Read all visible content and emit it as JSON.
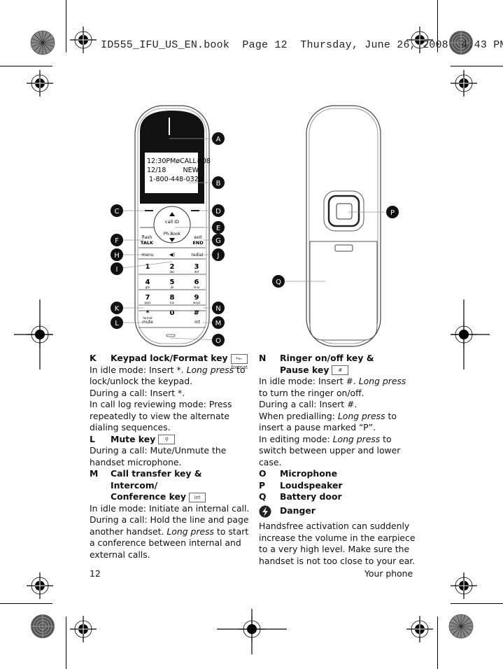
{
  "print_header": "ID555_IFU_US_EN.book  Page 12  Thursday, June 26, 2008  4:43 PM",
  "figure": {
    "lcd_lines": [
      "12:30PMøCALL#08",
      "12/18        NEW",
      " 1-800-448-0329"
    ],
    "callouts_front": [
      "A",
      "B",
      "C",
      "D",
      "E",
      "F",
      "G",
      "H",
      "I",
      "J",
      "K",
      "L",
      "M",
      "N",
      "O"
    ],
    "callouts_back": [
      "P",
      "Q"
    ],
    "keys": {
      "call_id": "call ID",
      "ph_book": "Ph.Book",
      "flash": "flash",
      "talk": "TALK",
      "exit": "exit",
      "end": "END",
      "menu": "menu",
      "redial": "redial",
      "mute": "mute",
      "int": "int",
      "format": "format",
      "digits": [
        {
          "d": "1",
          "s": ""
        },
        {
          "d": "2",
          "s": "abc"
        },
        {
          "d": "3",
          "s": "def"
        },
        {
          "d": "4",
          "s": "ghi"
        },
        {
          "d": "5",
          "s": "jkl"
        },
        {
          "d": "6",
          "s": "mno"
        },
        {
          "d": "7",
          "s": "pqrs"
        },
        {
          "d": "8",
          "s": "tuv"
        },
        {
          "d": "9",
          "s": "wxyz"
        },
        {
          "d": "*",
          "s": "format"
        },
        {
          "d": "0",
          "s": ""
        },
        {
          "d": "#",
          "s": ""
        }
      ]
    }
  },
  "left_column": {
    "K": {
      "letter": "K",
      "title": "Keypad lock/Format key",
      "icon": "*← format",
      "lines": [
        {
          "pre": "In idle mode: Insert *. ",
          "em": "Long press",
          "post": " to lock/unlock the keypad."
        },
        {
          "pre": "During a call: Insert *.",
          "em": "",
          "post": ""
        },
        {
          "pre": "In call log reviewing mode: Press repeatedly to view the alternate dialing sequences.",
          "em": "",
          "post": ""
        }
      ]
    },
    "L": {
      "letter": "L",
      "title": "Mute key",
      "icon": "🎙",
      "lines": [
        {
          "pre": "During a call: Mute/Unmute the handset microphone.",
          "em": "",
          "post": ""
        }
      ]
    },
    "M": {
      "letter": "M",
      "title_1": "Call transfer key & Intercom/",
      "title_2": "Conference key",
      "icon": "int",
      "lines": [
        {
          "pre": "In idle mode: Initiate an internal call.",
          "em": "",
          "post": ""
        },
        {
          "pre": "During a call: Hold the line and page another handset. ",
          "em": "Long press",
          "post": " to start a conference between internal and external calls."
        }
      ]
    }
  },
  "right_column": {
    "N": {
      "letter": "N",
      "title_1": "Ringer on/off key &",
      "title_2": "Pause key",
      "icon": "#",
      "lines": [
        {
          "pre": "In idle mode: Insert #. ",
          "em": "Long press",
          "post": " to turn the ringer on/off."
        },
        {
          "pre": "During a call: Insert #.",
          "em": "",
          "post": ""
        },
        {
          "pre": "When predialling: ",
          "em": "Long press",
          "post": " to insert a pause marked “P”."
        },
        {
          "pre": "In editing mode: ",
          "em": "Long press",
          "post": " to switch between upper and lower case."
        }
      ]
    },
    "O": {
      "letter": "O",
      "title": "Microphone"
    },
    "P": {
      "letter": "P",
      "title": "Loudspeaker"
    },
    "Q": {
      "letter": "Q",
      "title": "Battery door"
    },
    "danger": {
      "title": "Danger",
      "icon": "danger-icon",
      "text": "Handsfree activation can suddenly increase the volume in the earpiece to a very high level. Make sure the handset is not too close to your ear."
    }
  },
  "footer": {
    "page_number": "12",
    "section": "Your phone"
  }
}
